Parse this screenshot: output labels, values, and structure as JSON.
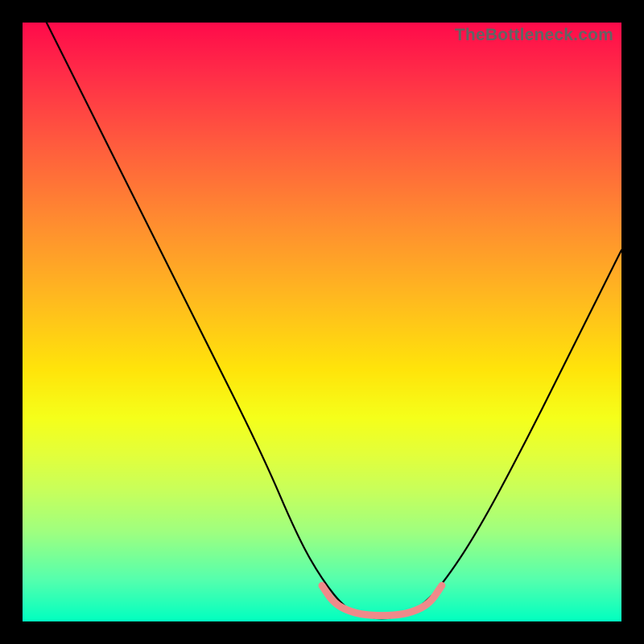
{
  "watermark": "TheBottleneck.com",
  "chart_data": {
    "type": "line",
    "title": "",
    "xlabel": "",
    "ylabel": "",
    "xlim": [
      0,
      100
    ],
    "ylim": [
      0,
      100
    ],
    "grid": false,
    "legend": false,
    "series": [
      {
        "name": "bottleneck-curve",
        "color": "#000000",
        "x": [
          4,
          10,
          20,
          30,
          40,
          46,
          50,
          54,
          58,
          62,
          66,
          70,
          76,
          84,
          92,
          100
        ],
        "y": [
          100,
          88,
          68,
          48,
          28,
          14,
          7,
          2,
          0.5,
          0.5,
          2,
          6,
          15,
          30,
          46,
          62
        ]
      },
      {
        "name": "optimal-region",
        "color": "#f07878",
        "x": [
          50,
          52,
          55,
          58,
          62,
          65,
          68,
          70
        ],
        "y": [
          6,
          3,
          1.5,
          1,
          1,
          1.5,
          3,
          6
        ]
      }
    ],
    "gradient_stops": [
      {
        "pos": 0,
        "color": "#ff0a4a"
      },
      {
        "pos": 20,
        "color": "#ff5a3e"
      },
      {
        "pos": 46,
        "color": "#ffe40a"
      },
      {
        "pos": 78,
        "color": "#c8ff5a"
      },
      {
        "pos": 100,
        "color": "#00ffc0"
      }
    ]
  }
}
